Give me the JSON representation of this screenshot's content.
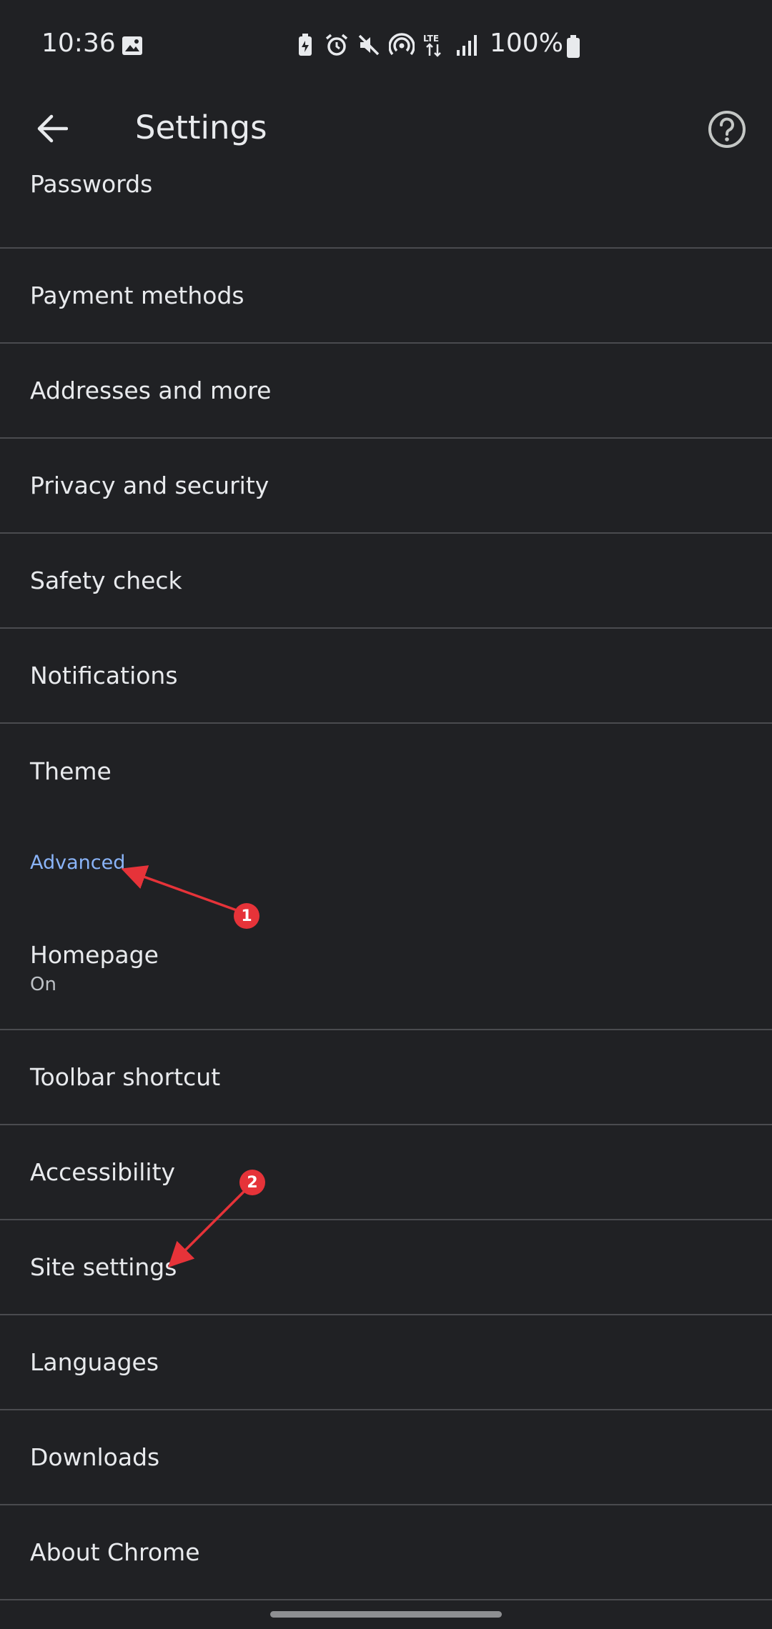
{
  "status_bar": {
    "time": "10:36",
    "battery_percent": "100%",
    "icons": [
      "gallery-icon",
      "battery-saver-icon",
      "alarm-icon",
      "mute-icon",
      "hotspot-icon",
      "lte-icon",
      "signal-icon",
      "battery-icon"
    ],
    "lte_label": "LTE"
  },
  "app_bar": {
    "title": "Settings",
    "back_icon": "arrow-left-icon",
    "help_icon": "help-circle-icon"
  },
  "settings": {
    "items": [
      {
        "label": "Passwords"
      },
      {
        "label": "Payment methods"
      },
      {
        "label": "Addresses and more"
      },
      {
        "label": "Privacy and security"
      },
      {
        "label": "Safety check"
      },
      {
        "label": "Notifications"
      },
      {
        "label": "Theme"
      }
    ],
    "advanced_header": "Advanced",
    "advanced_items": [
      {
        "label": "Homepage",
        "sublabel": "On"
      },
      {
        "label": "Toolbar shortcut"
      },
      {
        "label": "Accessibility"
      },
      {
        "label": "Site settings"
      },
      {
        "label": "Languages"
      },
      {
        "label": "Downloads"
      },
      {
        "label": "About Chrome"
      }
    ]
  },
  "annotations": {
    "badge_1": "1",
    "badge_2": "2",
    "color": "#e63339"
  },
  "colors": {
    "background": "#202124",
    "text": "#e8eaed",
    "accent": "#8ab4f8",
    "divider": "#4a4b4f"
  }
}
